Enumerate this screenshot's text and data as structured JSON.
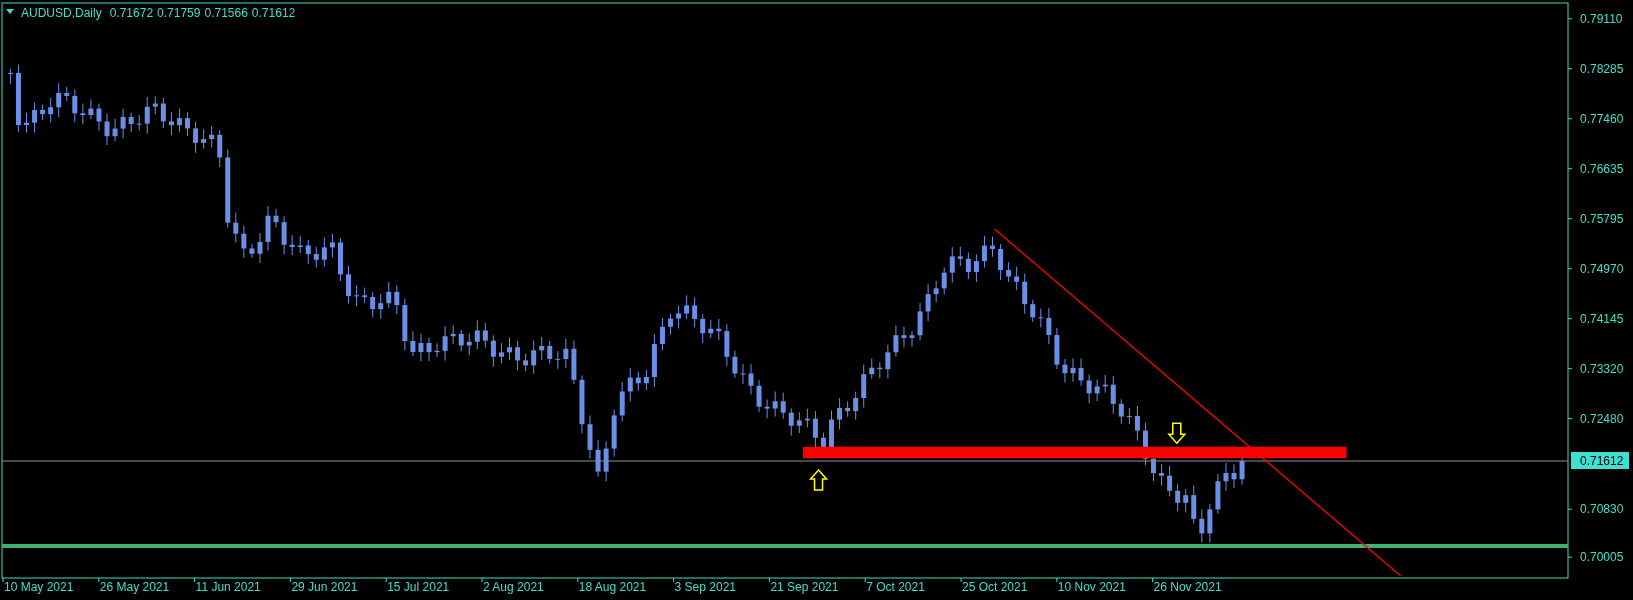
{
  "chart": {
    "symbol": "AUDUSD,Daily",
    "ohlc": [
      "0.71672",
      "0.71759",
      "0.71566",
      "0.71612"
    ],
    "price_axis": [
      "0.79110",
      "0.78285",
      "0.77460",
      "0.76635",
      "0.75795",
      "0.74970",
      "0.74145",
      "0.73320",
      "0.72480",
      "0.70830",
      "0.70005"
    ],
    "current_price": "0.71612",
    "time_axis": [
      "10 May 2021",
      "26 May 2021",
      "11 Jun 2021",
      "29 Jun 2021",
      "15 Jul 2021",
      "2 Aug 2021",
      "18 Aug 2021",
      "3 Sep 2021",
      "21 Sep 2021",
      "7 Oct 2021",
      "25 Oct 2021",
      "10 Nov 2021",
      "26 Nov 2021"
    ]
  }
}
